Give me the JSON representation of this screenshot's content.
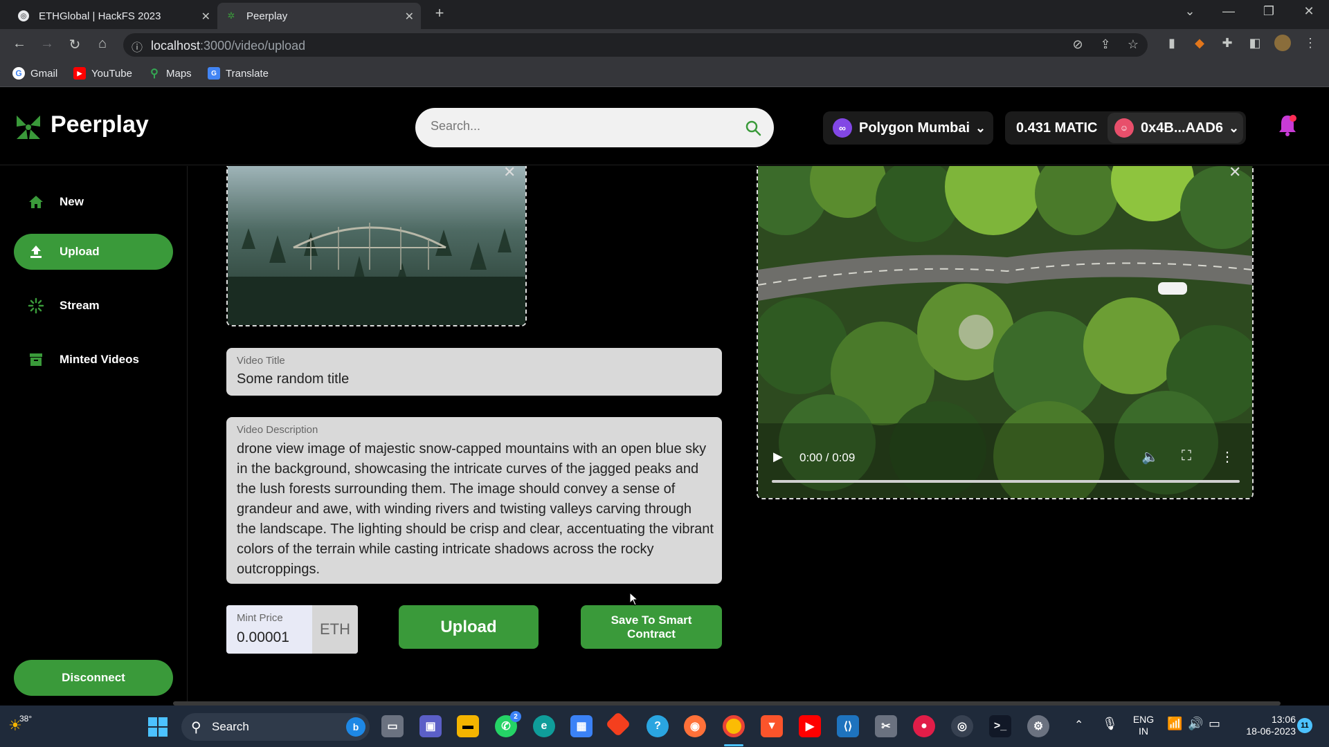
{
  "browser": {
    "tabs": [
      {
        "title": "ETHGlobal | HackFS 2023",
        "active": false
      },
      {
        "title": "Peerplay",
        "active": true
      }
    ],
    "url_host": "localhost",
    "url_path": ":3000/video/upload",
    "bookmarks": [
      "Gmail",
      "YouTube",
      "Maps",
      "Translate"
    ]
  },
  "header": {
    "logo_text": "Peerplay",
    "search_placeholder": "Search...",
    "network": "Polygon Mumbai",
    "balance": "0.431 MATIC",
    "account": "0x4B...AAD6"
  },
  "sidebar": {
    "items": [
      {
        "label": "New",
        "icon": "home-icon",
        "active": false
      },
      {
        "label": "Upload",
        "icon": "upload-icon",
        "active": true
      },
      {
        "label": "Stream",
        "icon": "stream-icon",
        "active": false
      },
      {
        "label": "Minted Videos",
        "icon": "archive-icon",
        "active": false
      }
    ],
    "disconnect_label": "Disconnect"
  },
  "form": {
    "title_label": "Video Title",
    "title_value": "Some random title",
    "description_label": "Video Description",
    "description_value": "drone view image of majestic snow-capped mountains with an open blue sky in the background, showcasing the intricate curves of the jagged peaks and the lush forests surrounding them. The image should convey a sense of grandeur and awe, with winding rivers and twisting valleys carving through the landscape. The lighting should be crisp and clear, accentuating the vibrant colors of the terrain while casting intricate shadows across the rocky outcroppings.",
    "price_label": "Mint Price",
    "price_value": "0.00001",
    "price_unit": "ETH",
    "upload_label": "Upload",
    "save_label": "Save To Smart Contract"
  },
  "video": {
    "time": "0:00 / 0:09"
  },
  "taskbar": {
    "weather": "38°",
    "search_label": "Search",
    "lang_line1": "ENG",
    "lang_line2": "IN",
    "time": "13:06",
    "date": "18-06-2023",
    "notification_count": "11",
    "whatsapp_badge": "2"
  },
  "colors": {
    "brand_green": "#3a9a3a",
    "background": "#000000"
  }
}
